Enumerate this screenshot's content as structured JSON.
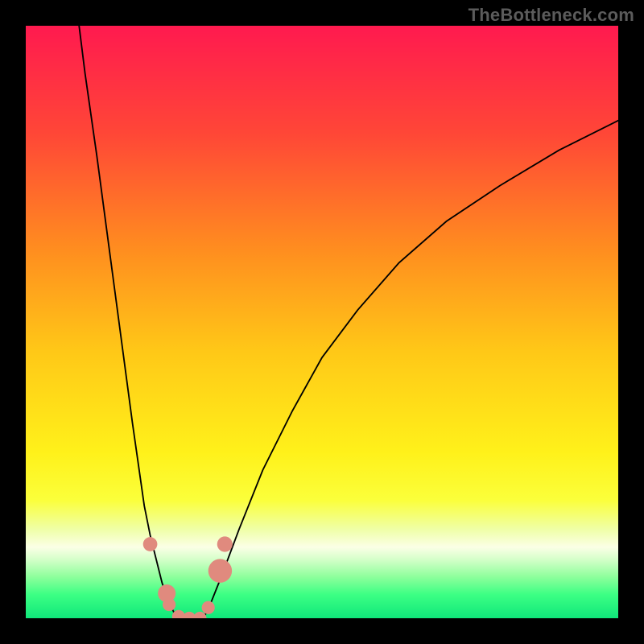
{
  "watermark": "TheBottleneck.com",
  "chart_data": {
    "type": "line",
    "title": "",
    "xlabel": "",
    "ylabel": "",
    "xlim": [
      0,
      100
    ],
    "ylim": [
      0,
      100
    ],
    "grid": false,
    "legend": false,
    "annotations": [],
    "note": "V-shaped bottleneck curve over a vertical red→yellow→green gradient. No axis ticks or data labels are rendered; values below are visual estimates in percent of plot width (x) and plot height (y, 0 at bottom).",
    "series": [
      {
        "name": "left-branch",
        "x": [
          9,
          10,
          12,
          14,
          16,
          18,
          19,
          20,
          21,
          22,
          23,
          24,
          25,
          26
        ],
        "y": [
          100,
          92,
          78,
          63,
          48,
          33,
          26,
          19,
          14,
          10,
          6,
          3,
          1,
          0
        ]
      },
      {
        "name": "right-branch",
        "x": [
          30,
          31,
          33,
          36,
          40,
          45,
          50,
          56,
          63,
          71,
          80,
          90,
          100
        ],
        "y": [
          0,
          2,
          7,
          15,
          25,
          35,
          44,
          52,
          60,
          67,
          73,
          79,
          84
        ]
      }
    ],
    "markers": [
      {
        "name": "left-dot-upper",
        "x": 21.0,
        "y": 12.5,
        "r": 1.2
      },
      {
        "name": "left-dot-mid",
        "x": 23.8,
        "y": 4.2,
        "r": 1.5
      },
      {
        "name": "left-dot-low",
        "x": 24.2,
        "y": 2.3,
        "r": 1.1
      },
      {
        "name": "bottom-dot-l",
        "x": 25.8,
        "y": 0.3,
        "r": 1.1
      },
      {
        "name": "bottom-dot-c1",
        "x": 27.6,
        "y": 0.0,
        "r": 1.1
      },
      {
        "name": "bottom-dot-c2",
        "x": 29.4,
        "y": 0.0,
        "r": 1.1
      },
      {
        "name": "right-dot-low",
        "x": 30.8,
        "y": 1.8,
        "r": 1.1
      },
      {
        "name": "right-dot-mid",
        "x": 32.8,
        "y": 8.0,
        "r": 2.0
      },
      {
        "name": "right-dot-upper",
        "x": 33.6,
        "y": 12.5,
        "r": 1.3
      }
    ],
    "gradient_stops": [
      {
        "pct": 0,
        "color": "#ff1a4f"
      },
      {
        "pct": 18,
        "color": "#ff4637"
      },
      {
        "pct": 38,
        "color": "#ff8e1f"
      },
      {
        "pct": 55,
        "color": "#ffc817"
      },
      {
        "pct": 72,
        "color": "#fff11a"
      },
      {
        "pct": 80,
        "color": "#fbff3a"
      },
      {
        "pct": 85,
        "color": "#efffa7"
      },
      {
        "pct": 88,
        "color": "#fbffe6"
      },
      {
        "pct": 90,
        "color": "#d6ffca"
      },
      {
        "pct": 93,
        "color": "#8eff9c"
      },
      {
        "pct": 96,
        "color": "#3cff84"
      },
      {
        "pct": 100,
        "color": "#10e77a"
      }
    ],
    "marker_color": "#e08a7e",
    "curve_color": "#000000"
  }
}
